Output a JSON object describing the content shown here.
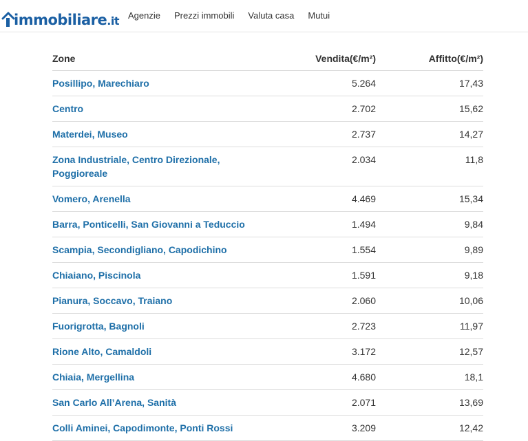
{
  "brand": {
    "name": "immobiliare",
    "tld": ".it",
    "color": "#1a5fa3"
  },
  "nav": [
    {
      "label": "Agenzie"
    },
    {
      "label": "Prezzi immobili"
    },
    {
      "label": "Valuta casa"
    },
    {
      "label": "Mutui"
    }
  ],
  "table": {
    "headers": {
      "zone": "Zone",
      "sale": "Vendita(€/m²)",
      "rent": "Affitto(€/m²)"
    },
    "rows": [
      {
        "zone": "Posillipo, Marechiaro",
        "sale": "5.264",
        "rent": "17,43"
      },
      {
        "zone": "Centro",
        "sale": "2.702",
        "rent": "15,62"
      },
      {
        "zone": "Materdei, Museo",
        "sale": "2.737",
        "rent": "14,27"
      },
      {
        "zone": "Zona Industriale, Centro Direzionale, Poggioreale",
        "sale": "2.034",
        "rent": "11,8"
      },
      {
        "zone": "Vomero, Arenella",
        "sale": "4.469",
        "rent": "15,34"
      },
      {
        "zone": "Barra, Ponticelli, San Giovanni a Teduccio",
        "sale": "1.494",
        "rent": "9,84"
      },
      {
        "zone": "Scampia, Secondigliano, Capodichino",
        "sale": "1.554",
        "rent": "9,89"
      },
      {
        "zone": "Chiaiano, Piscinola",
        "sale": "1.591",
        "rent": "9,18"
      },
      {
        "zone": "Pianura, Soccavo, Traiano",
        "sale": "2.060",
        "rent": "10,06"
      },
      {
        "zone": "Fuorigrotta, Bagnoli",
        "sale": "2.723",
        "rent": "11,97"
      },
      {
        "zone": "Rione Alto, Camaldoli",
        "sale": "3.172",
        "rent": "12,57"
      },
      {
        "zone": "Chiaia, Mergellina",
        "sale": "4.680",
        "rent": "18,1"
      },
      {
        "zone": "San Carlo All’Arena, Sanità",
        "sale": "2.071",
        "rent": "13,69"
      },
      {
        "zone": "Colli Aminei, Capodimonte, Ponti Rossi",
        "sale": "3.209",
        "rent": "12,42"
      }
    ]
  }
}
